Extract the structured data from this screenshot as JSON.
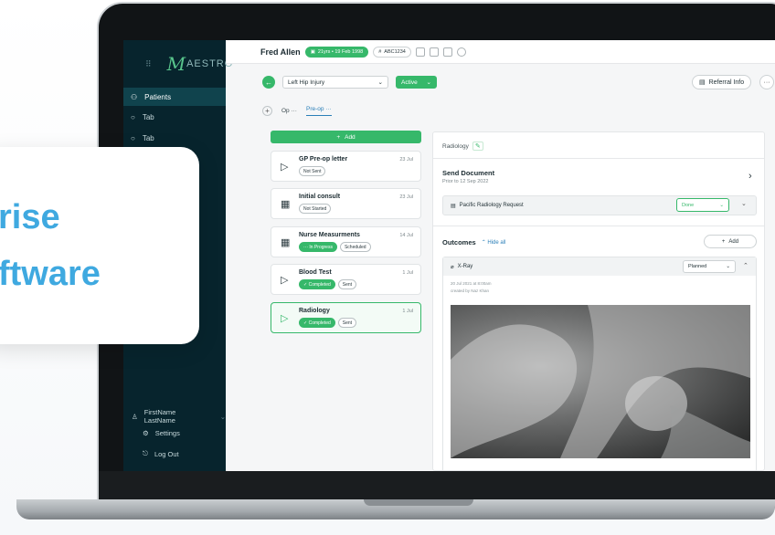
{
  "promo": {
    "line1": "rise",
    "line2": "ftware"
  },
  "sidebar": {
    "logo_letter": "M",
    "logo_text": "AESTRO",
    "items": [
      {
        "label": "Patients",
        "icon": "patients-icon"
      },
      {
        "label": "Tab",
        "icon": "circle-icon"
      },
      {
        "label": "Tab",
        "icon": "circle-icon"
      }
    ],
    "user_name": "FirstName LastName",
    "settings_label": "Settings",
    "logout_label": "Log Out"
  },
  "header": {
    "patient_name": "Fred Allen",
    "age_dob": "21yrs • 19 Feb 1998",
    "patient_id": "ABC1234"
  },
  "subbar": {
    "case_select": "Left Hip Injury",
    "status_select": "Active",
    "referral_label": "Referral Info",
    "more_label": "···"
  },
  "tabs": [
    {
      "label": "Op ···"
    },
    {
      "label": "Pre-op ···"
    }
  ],
  "tasks": {
    "add_label": "Add",
    "items": [
      {
        "title": "GP Pre-op letter",
        "date": "23 Jul",
        "badges": [
          {
            "text": "Not Sent",
            "style": "outline"
          }
        ],
        "icon": "send-icon"
      },
      {
        "title": "Initial consult",
        "date": "23 Jul",
        "badges": [
          {
            "text": "Not Started",
            "style": "outline"
          }
        ],
        "icon": "calendar-icon"
      },
      {
        "title": "Nurse Measurments",
        "date": "14 Jul",
        "badges": [
          {
            "text": "··· In Progress",
            "style": "green"
          },
          {
            "text": "Scheduled",
            "style": "outline"
          }
        ],
        "icon": "calendar-icon"
      },
      {
        "title": "Blood Test",
        "date": "1 Jul",
        "badges": [
          {
            "text": "✓ Completed",
            "style": "green"
          },
          {
            "text": "Sent",
            "style": "outline"
          }
        ],
        "icon": "send-icon"
      },
      {
        "title": "Radiology",
        "date": "1 Jul",
        "badges": [
          {
            "text": "✓ Completed",
            "style": "green"
          },
          {
            "text": "Sent",
            "style": "outline"
          }
        ],
        "icon": "send-icon"
      }
    ]
  },
  "panel": {
    "title": "Radiology",
    "send_title": "Send Document",
    "send_sub": "Prior to 12 Sep 2022",
    "request_label": "Pacific Radiology Request",
    "request_status": "Done",
    "outcomes_label": "Outcomes",
    "hide_all_label": "Hide all",
    "outcomes_add_label": "Add",
    "xray_label": "X-Ray",
    "xray_status": "Planned",
    "xray_date": "20 Jul 2021 at 8:00am",
    "xray_author": "created by Naz Khan"
  },
  "colors": {
    "accent": "#36b86a",
    "sidebar": "#07242d",
    "link": "#2a7fb8",
    "promo": "#3fa9e0"
  }
}
